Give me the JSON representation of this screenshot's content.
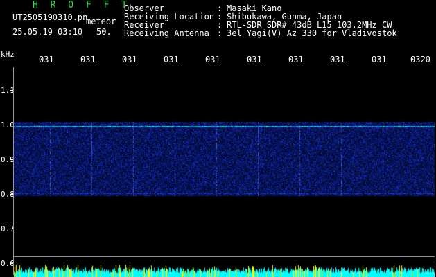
{
  "header": {
    "brand": "H R O F F T",
    "file_name": "UT2505190310.pn",
    "mode_label": "meteor",
    "date_time": "25.05.19 03:10",
    "frame_no": "50."
  },
  "info": [
    {
      "label": "Observer",
      "value": "Masaki Kano"
    },
    {
      "label": "Receiving Location",
      "value": "Shibukawa, Gunma, Japan"
    },
    {
      "label": "Receiver",
      "value": "RTL-SDR SDR# 43dB L15 103.2MHz CW"
    },
    {
      "label": "Receiving Antenna",
      "value": "3el Yagi(V) Az 330 for Vladivostok"
    }
  ],
  "separator": ":",
  "axis": {
    "y_unit": "kHz",
    "y_ticks": [
      "1.1",
      "1.0",
      "0.9",
      "0.8",
      "0.7",
      "0.6"
    ],
    "x_ticks": [
      "031",
      "031",
      "031",
      "031",
      "031",
      "031",
      "031",
      "031",
      "031",
      "0320"
    ]
  },
  "colors": {
    "background": "#000000",
    "brand": "#33dd55",
    "echo_bright": "#66ddaa",
    "noise": "#1428c8",
    "level_cyan": "#00ffff",
    "level_yellow": "#ffff00"
  },
  "signal": {
    "band_top_khz": 1.0,
    "band_bottom_khz": 0.8,
    "carrier_khz": 0.99
  }
}
